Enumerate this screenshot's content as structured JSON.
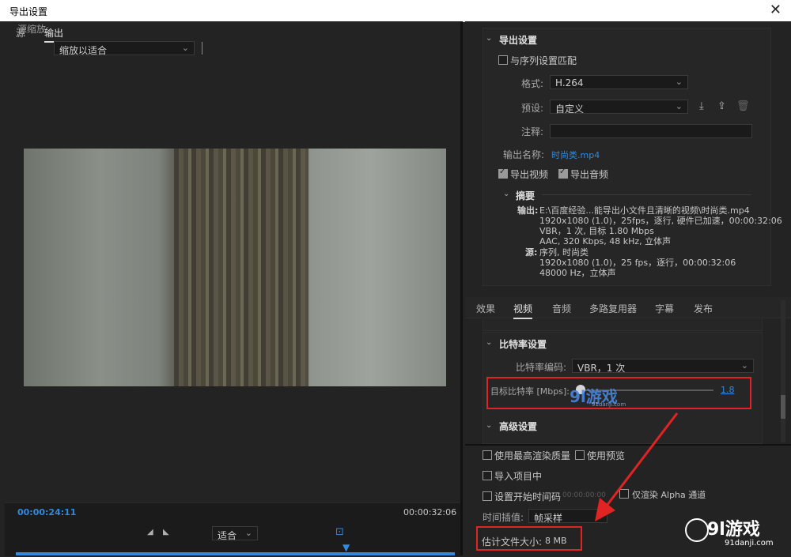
{
  "window": {
    "title": "导出设置",
    "close_glyph": "✕"
  },
  "left": {
    "tabs": [
      {
        "label": "源"
      },
      {
        "label": "输出"
      }
    ],
    "zoom_label": "源缩放:",
    "zoom_value": "缩放以适合",
    "timecode_current": "00:00:24:11",
    "timecode_end": "00:00:32:06",
    "fit_value": "适合"
  },
  "export": {
    "section_title": "导出设置",
    "match_sequence_label": "与序列设置匹配",
    "format_label": "格式:",
    "format_value": "H.264",
    "preset_label": "预设:",
    "preset_value": "自定义",
    "comment_label": "注释:",
    "output_name_label": "输出名称:",
    "output_name_value": "时尚类.mp4",
    "export_video_label": "导出视频",
    "export_audio_label": "导出音频",
    "summary_title": "摘要",
    "output_label": "输出:",
    "output_lines": [
      "E:\\百度经验...能导出小文件且清晰的视频\\时尚类.mp4",
      "1920x1080 (1.0)，25fps，逐行, 硬件已加速，00:00:32:06",
      "VBR，1 次, 目标 1.80 Mbps",
      "AAC, 320 Kbps, 48  kHz, 立体声"
    ],
    "source_label": "源:",
    "source_lines": [
      "序列, 时尚类",
      "1920x1080 (1.0)，25 fps，逐行，00:00:32:06",
      "48000  Hz，立体声"
    ]
  },
  "tabs2": [
    {
      "label": "效果"
    },
    {
      "label": "视频"
    },
    {
      "label": "音频"
    },
    {
      "label": "多路复用器"
    },
    {
      "label": "字幕"
    },
    {
      "label": "发布"
    }
  ],
  "bitrate": {
    "section_title": "比特率设置",
    "encoding_label": "比特率编码:",
    "encoding_value": "VBR，1 次",
    "target_label": "目标比特率 [Mbps]:",
    "target_value": "1.8",
    "advanced_title": "高级设置"
  },
  "bottom": {
    "max_render_label": "使用最高渲染质量",
    "use_preview_label": "使用预览",
    "import_project_label": "导入项目中",
    "set_start_tc_label": "设置开始时间码",
    "start_tc_value": "00:00:00:00",
    "alpha_only_label": "仅渲染 Alpha 通道",
    "interp_label": "时间插值:",
    "interp_value": "帧采样",
    "est_size_label": "估计文件大小:",
    "est_size_value": "8 MB"
  },
  "watermark": {
    "name": "9l游戏",
    "url": "91danji.com",
    "center_name": "9l游戏",
    "center_url": "91danji.com"
  },
  "colors": {
    "accent": "#2f8ae0",
    "highlight": "#e02323"
  }
}
